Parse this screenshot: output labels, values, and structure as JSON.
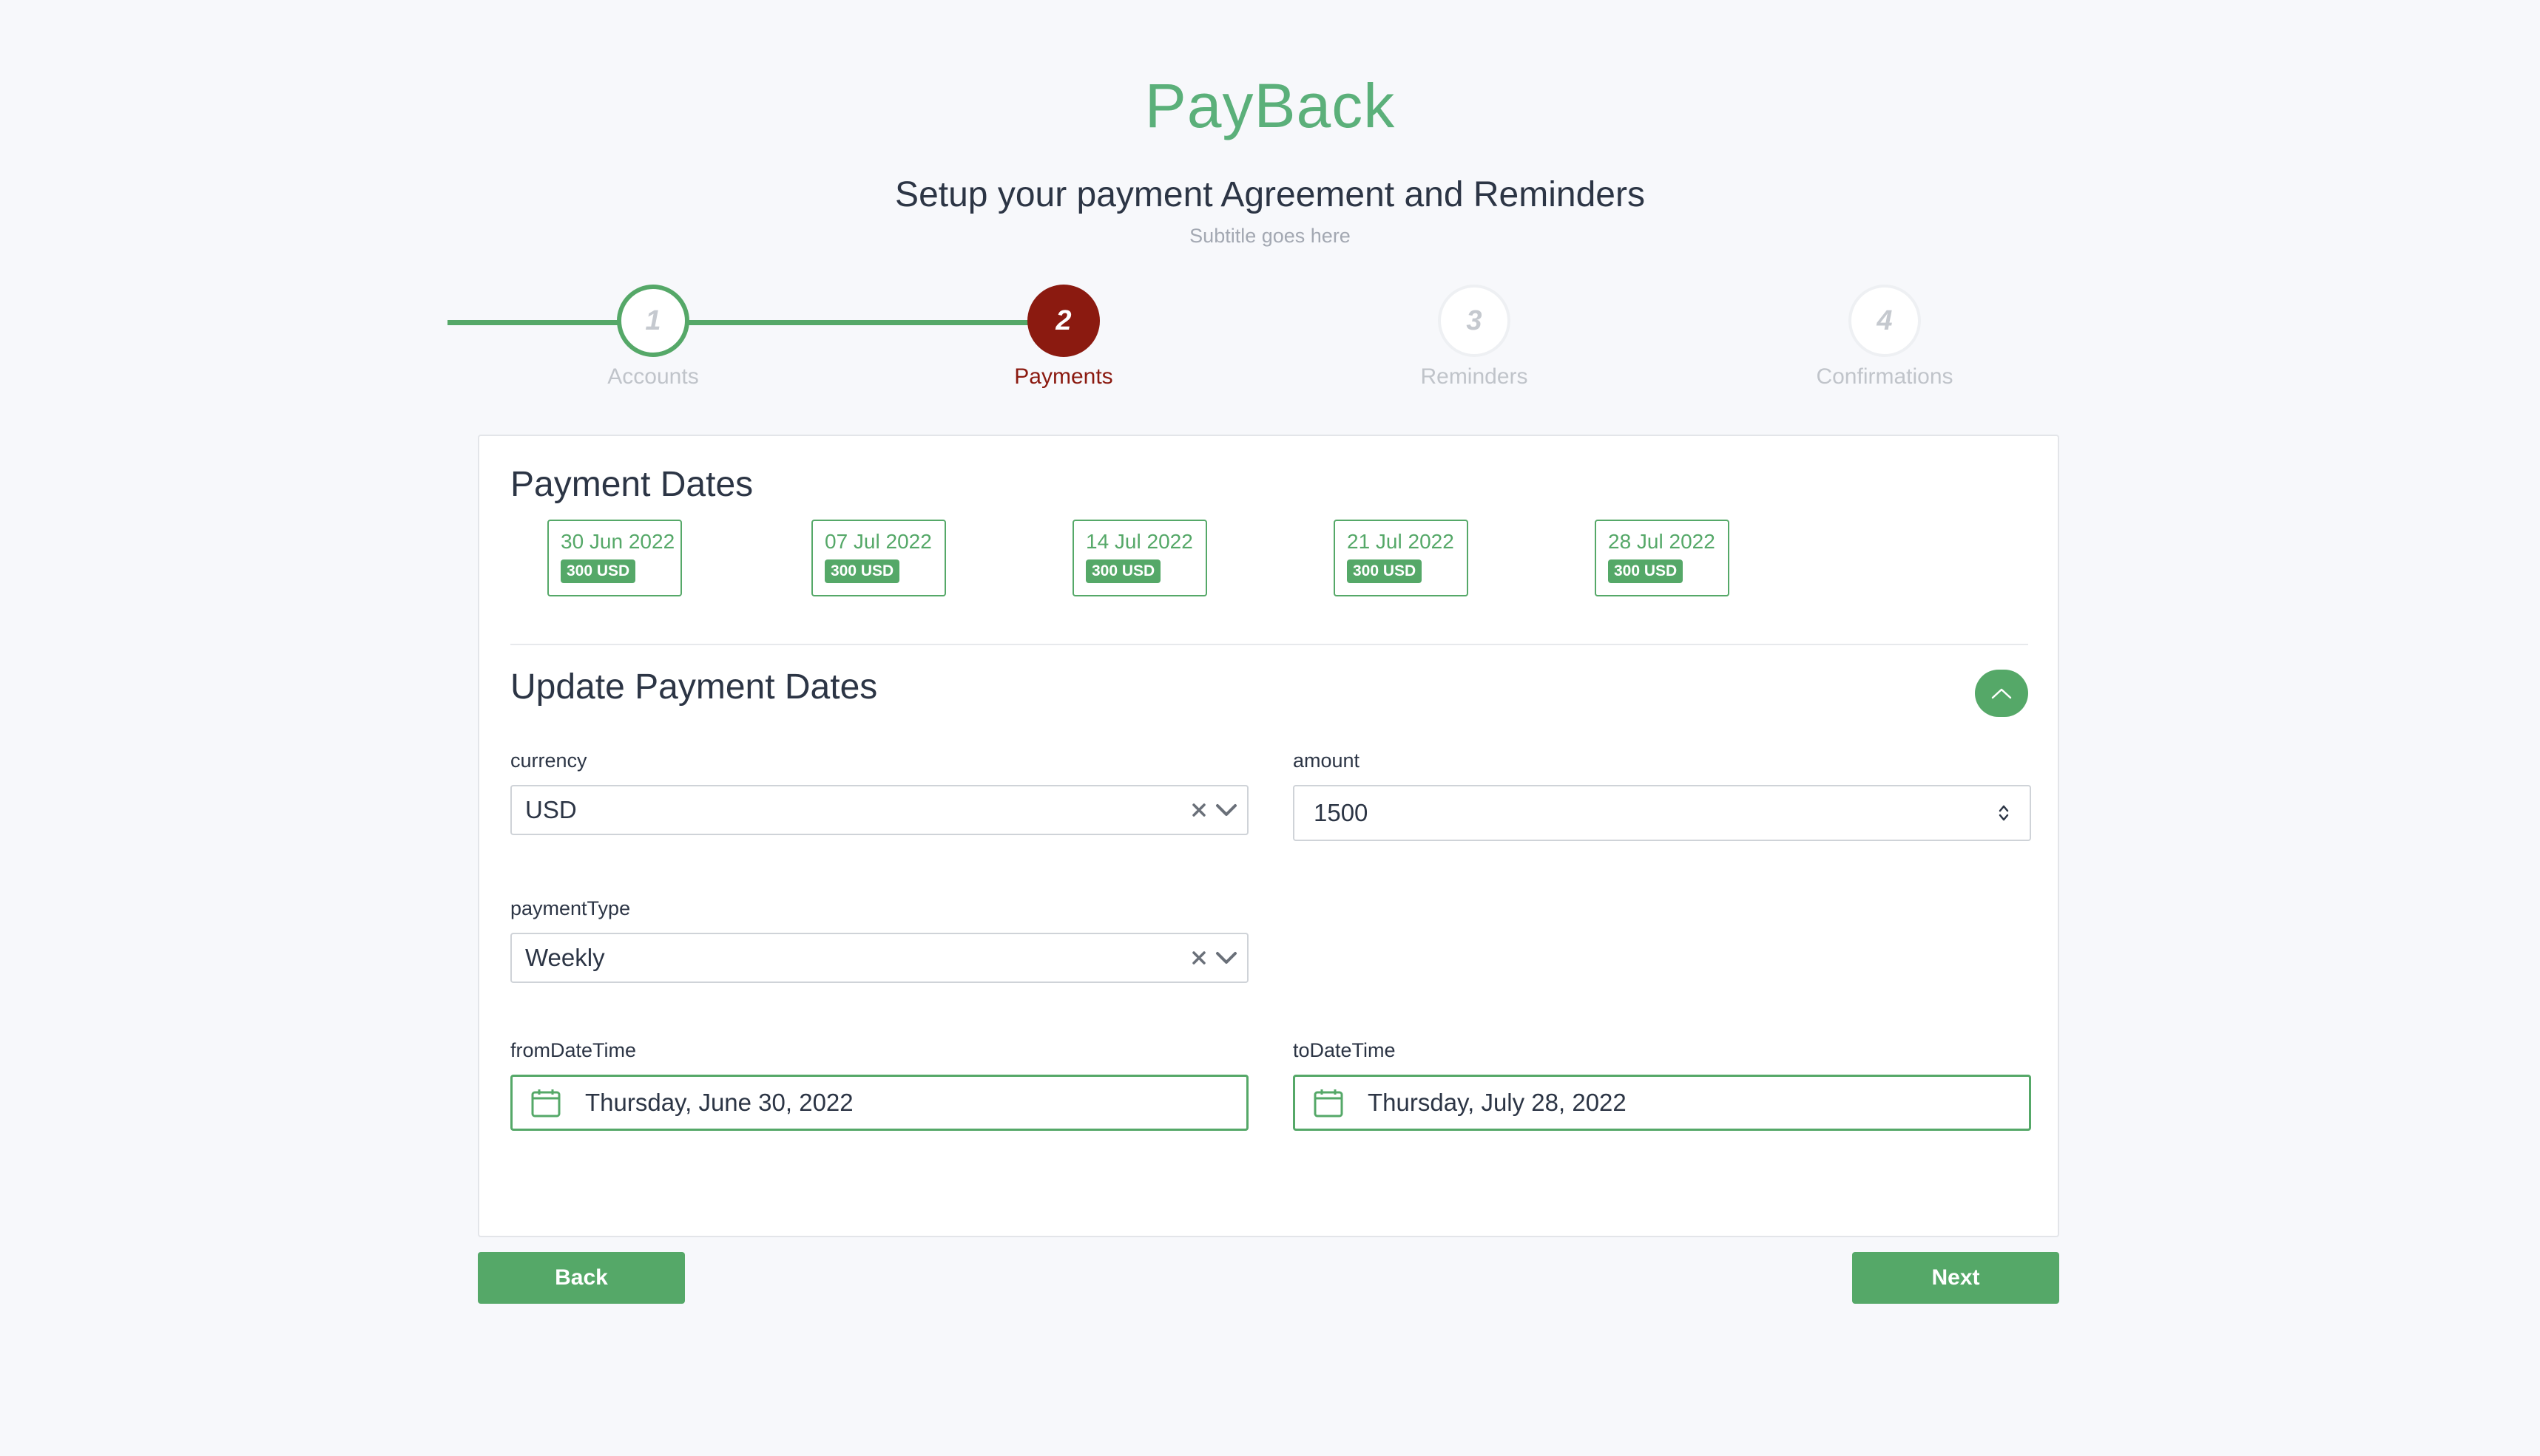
{
  "app": {
    "brand": "PayBack",
    "headline": "Setup your payment Agreement and Reminders",
    "subtitle": "Subtitle goes here"
  },
  "stepper": {
    "steps": [
      {
        "number": "1",
        "label": "Accounts",
        "state": "done"
      },
      {
        "number": "2",
        "label": "Payments",
        "state": "active"
      },
      {
        "number": "3",
        "label": "Reminders",
        "state": "todo"
      },
      {
        "number": "4",
        "label": "Confirmations",
        "state": "todo"
      }
    ]
  },
  "payment_dates": {
    "title": "Payment Dates",
    "items": [
      {
        "date": "30 Jun 2022",
        "amount": "300 USD"
      },
      {
        "date": "07 Jul 2022",
        "amount": "300 USD"
      },
      {
        "date": "14 Jul 2022",
        "amount": "300 USD"
      },
      {
        "date": "21 Jul 2022",
        "amount": "300 USD"
      },
      {
        "date": "28 Jul 2022",
        "amount": "300 USD"
      }
    ]
  },
  "update_form": {
    "title": "Update Payment Dates",
    "currency": {
      "label": "currency",
      "value": "USD"
    },
    "amount": {
      "label": "amount",
      "value": "1500"
    },
    "payment_type": {
      "label": "paymentType",
      "value": "Weekly"
    },
    "from_date": {
      "label": "fromDateTime",
      "value": "Thursday, June 30, 2022"
    },
    "to_date": {
      "label": "toDateTime",
      "value": "Thursday, July 28, 2022"
    }
  },
  "actions": {
    "back": "Back",
    "next": "Next"
  },
  "colors": {
    "accent": "#55a868",
    "active_step": "#8b1a10",
    "background": "#f7f8fb"
  },
  "icons": {
    "clear": "clear-x-icon",
    "dropdown": "chevron-down-icon",
    "collapse": "chevron-up-icon",
    "calendar": "calendar-icon",
    "spinner": "number-spinner-icon"
  }
}
